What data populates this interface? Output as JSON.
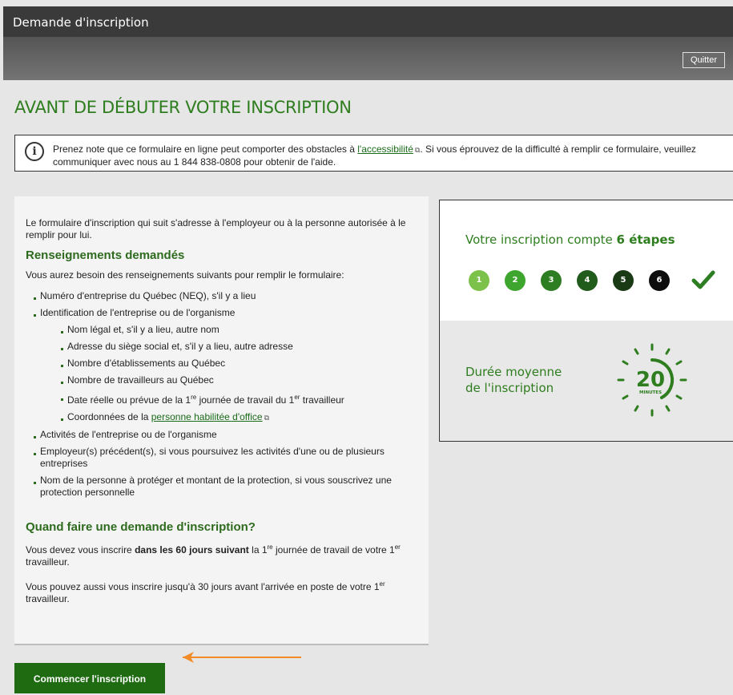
{
  "window": {
    "title": "Demande d'inscription"
  },
  "toolbar": {
    "quit_label": "Quitter"
  },
  "page": {
    "title": "AVANT DE DÉBUTER VOTRE INSCRIPTION"
  },
  "notice": {
    "icon": "info-icon",
    "text_before": "Prenez note que ce formulaire en ligne peut comporter des obstacles à ",
    "link": "l'accessibilité",
    "text_after": ". Si vous éprouvez de la difficulté à remplir ce formulaire, veuillez communiquer avec nous au 1 844 838-0808 pour obtenir de l'aide."
  },
  "intro": {
    "text": "Le formulaire d'inscription qui suit s'adresse à l'employeur ou à la personne autorisée à le remplir pour lui.",
    "heading": "Renseignements demandés",
    "lead": "Vous aurez besoin des renseignements suivants pour remplir le formulaire:",
    "items": [
      "Numéro d'entreprise du Québec (NEQ), s'il y a lieu",
      "Identification de l'entreprise ou de l'organisme",
      "Activités de l'entreprise ou de l'organisme",
      "Employeur(s) précédent(s), si vous poursuivez les activités d'une ou de plusieurs entreprises",
      "Nom de la personne à protéger et montant de la protection, si vous souscrivez une protection personnelle"
    ],
    "subitems": [
      "Nom légal et, s'il y a lieu, autre nom",
      "Adresse du siège social et, s'il y a lieu, autre adresse",
      "Nombre d'établissements au Québec",
      "Nombre de travailleurs au Québec"
    ],
    "date_item": {
      "part1": "Date réelle ou prévue de la 1",
      "sup1": "re",
      "part2": " journée de travail du 1",
      "sup2": "er",
      "part3": " travailleur"
    },
    "contact_item": {
      "text": "Coordonnées de la ",
      "link": "personne habilitée d'office"
    }
  },
  "when": {
    "heading": "Quand faire une demande d'inscription?",
    "p1_a": "Vous devez vous inscrire ",
    "p1_bold": "dans les 60 jours suivant",
    "p1_b": " la 1",
    "p1_sup1": "re",
    "p1_c": " journée de travail de votre 1",
    "p1_sup2": "er",
    "p1_d": " travailleur.",
    "p2_a": "Vous pouvez aussi vous inscrire jusqu'à 30 jours avant l'arrivée en poste de votre 1",
    "p2_sup": "er",
    "p2_b": " travailleur."
  },
  "steps_box": {
    "title_prefix": "Votre inscription compte ",
    "title_bold": "6 étapes",
    "steps": [
      "1",
      "2",
      "3",
      "4",
      "5",
      "6"
    ],
    "step_colors": [
      "#7cc24a",
      "#3ea52e",
      "#2d7d22",
      "#225c1c",
      "#1a3a16",
      "#0d0d0d"
    ],
    "check_icon": "checkmark-icon",
    "check_color": "#2d7d22"
  },
  "duration_box": {
    "line1": "Durée moyenne",
    "line2": "de l'inscription",
    "minutes_value": "20",
    "minutes_label": "MINUTES",
    "icon": "stopwatch-icon"
  },
  "actions": {
    "start_label": "Commencer l'inscription"
  },
  "colors": {
    "accent_green": "#2e7d1e",
    "button_green": "#1e6b12",
    "arrow_orange": "#f28c28"
  }
}
